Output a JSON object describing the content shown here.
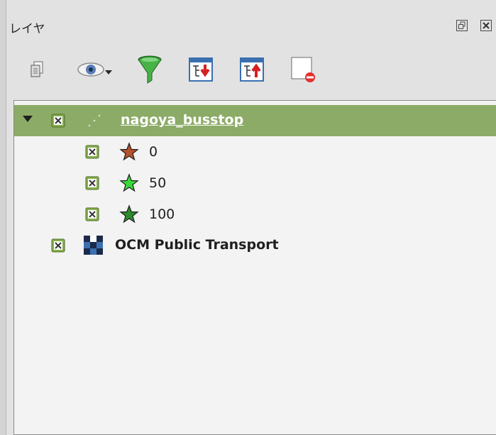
{
  "panel": {
    "title": "レイヤ"
  },
  "toolbar": {
    "buttons": [
      {
        "icon": "copy-layer-icon"
      },
      {
        "icon": "eye-visibility-icon"
      },
      {
        "icon": "filter-funnel-icon"
      },
      {
        "icon": "expand-all-icon"
      },
      {
        "icon": "collapse-all-icon"
      },
      {
        "icon": "remove-layer-icon"
      }
    ]
  },
  "tree": {
    "layer1": {
      "name": "nagoya_busstop",
      "checked": true,
      "expanded": true,
      "classes": [
        {
          "label": "0",
          "color": "#b5532b",
          "checked": true
        },
        {
          "label": "50",
          "color": "#3ad83a",
          "checked": true
        },
        {
          "label": "100",
          "color": "#2d8b2d",
          "checked": true
        }
      ]
    },
    "layer2": {
      "name": "OCM Public Transport",
      "checked": true
    }
  },
  "colors": {
    "selected_row": "#8cab66",
    "checkbox_fill": "#86b04b",
    "accent_blue": "#3a6fb0"
  }
}
